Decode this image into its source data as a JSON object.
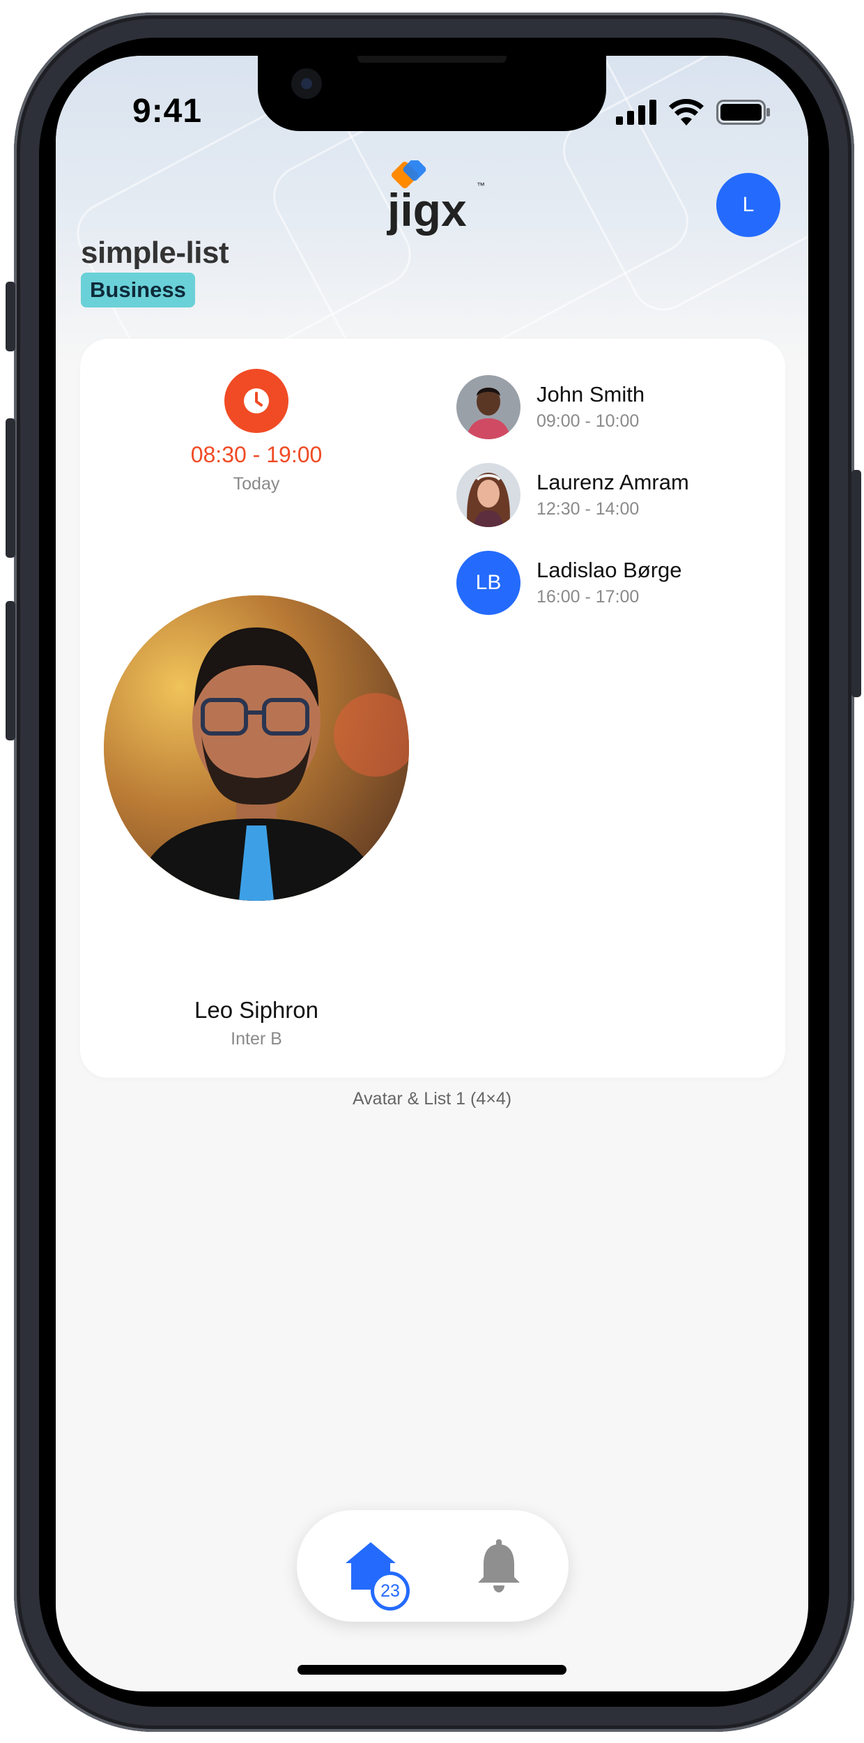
{
  "status_bar": {
    "time": "9:41"
  },
  "header": {
    "title": "simple-list",
    "badge": "Business",
    "logo_text": "jigx",
    "logo_mark": "™",
    "user_avatar_initial": "L"
  },
  "widget": {
    "schedule": {
      "time_range": "08:30 - 19:00",
      "day": "Today"
    },
    "featured": {
      "name": "Leo Siphron",
      "subtitle": "Inter B"
    },
    "list": [
      {
        "name": "John Smith",
        "time": "09:00 - 10:00"
      },
      {
        "name": "Laurenz Amram",
        "time": "12:30 - 14:00"
      },
      {
        "name": "Ladislao Børge",
        "time": "16:00 - 17:00",
        "initials": "LB"
      }
    ],
    "caption": "Avatar & List 1 (4×4)"
  },
  "tabbar": {
    "home_badge": "23"
  },
  "colors": {
    "accent": "#246bfd",
    "clock_red": "#f04b25",
    "badge_teal": "#6ad1d8",
    "logo_orange": "#ff8a00",
    "logo_blue": "#1e7cf2"
  },
  "icons": [
    "signal-icon",
    "wifi-icon",
    "battery-icon",
    "clock-icon",
    "home-icon",
    "bell-icon"
  ]
}
